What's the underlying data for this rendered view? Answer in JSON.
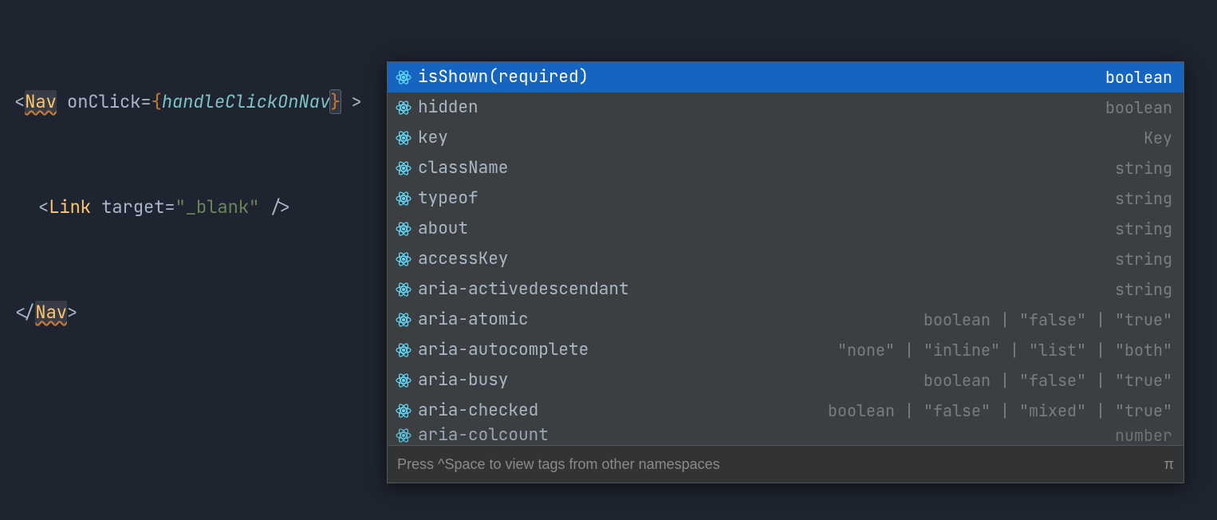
{
  "code": {
    "line1": {
      "open_bracket": "<",
      "navTag": "Nav",
      "attr": "onClick",
      "equals": "=",
      "brace_open": "{",
      "handler": "handleClickOnNav",
      "brace_close": "}",
      "close": ">"
    },
    "line2": {
      "open_bracket": "<",
      "linkTag": "Link",
      "attr": "target",
      "equals": "=",
      "value": "\"_blank\"",
      "selfclose": "/>"
    },
    "line3": {
      "open_close": "</",
      "navTag": "Nav",
      "close": ">"
    }
  },
  "popup": {
    "items": [
      {
        "label": "isShown",
        "req": "(required)",
        "type": "boolean",
        "selected": true
      },
      {
        "label": "hidden",
        "type": "boolean"
      },
      {
        "label": "key",
        "type": "Key"
      },
      {
        "label": "className",
        "type": "string"
      },
      {
        "label": "typeof",
        "type": "string"
      },
      {
        "label": "about",
        "type": "string"
      },
      {
        "label": "accessKey",
        "type": "string"
      },
      {
        "label": "aria-activedescendant",
        "type": "string"
      },
      {
        "label": "aria-atomic",
        "type": "boolean | \"false\" | \"true\""
      },
      {
        "label": "aria-autocomplete",
        "type": "\"none\" | \"inline\" | \"list\" | \"both\""
      },
      {
        "label": "aria-busy",
        "type": "boolean | \"false\" | \"true\""
      },
      {
        "label": "aria-checked",
        "type": "boolean | \"false\" | \"mixed\" | \"true\""
      },
      {
        "label": "aria-colcount",
        "type": "number",
        "partial": true
      }
    ],
    "hint": "Press ^Space to view tags from other namespaces",
    "pi": "π"
  }
}
